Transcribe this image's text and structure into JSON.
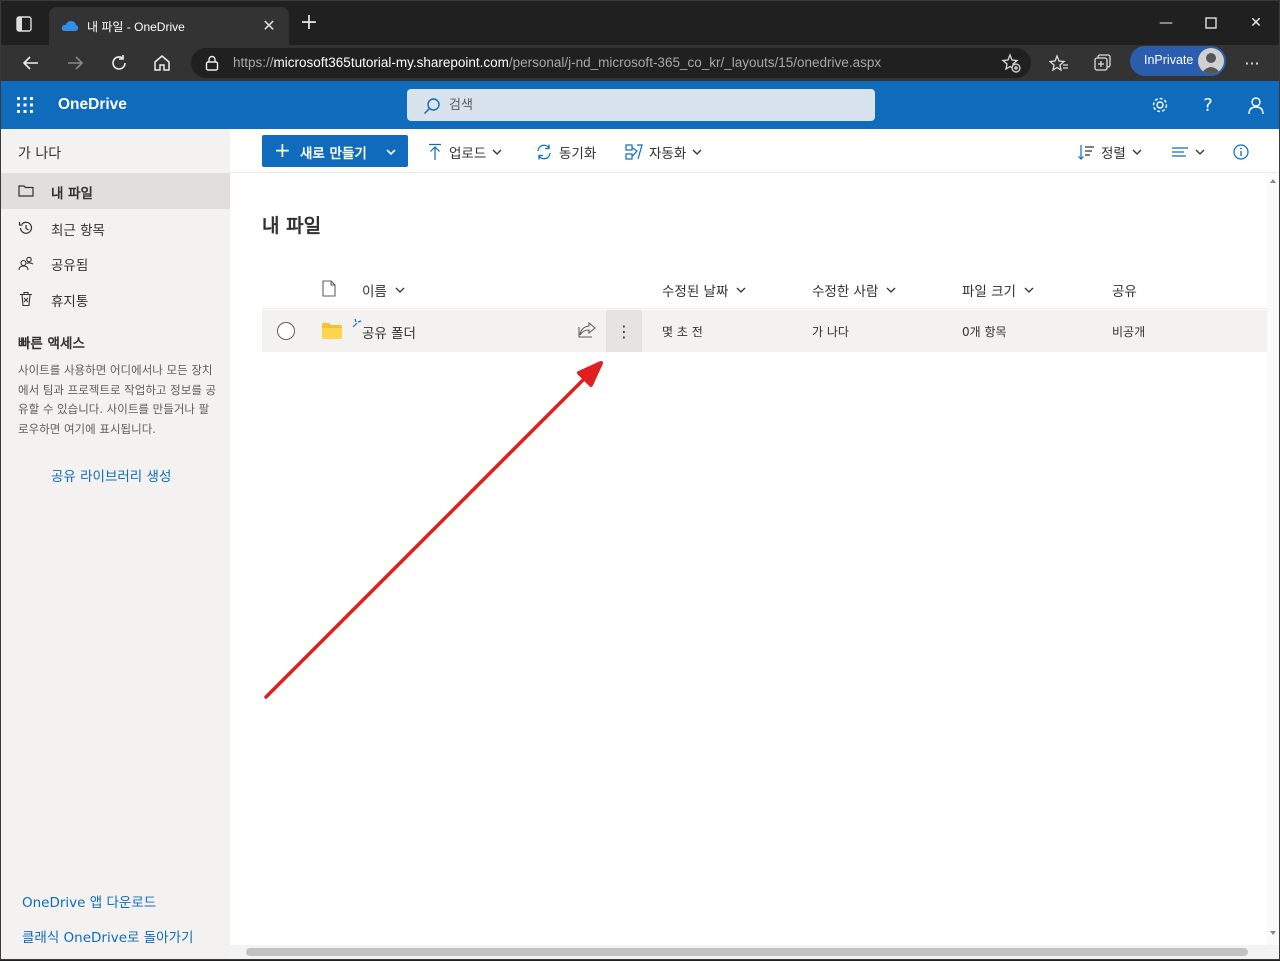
{
  "browser": {
    "tab_title": "내 파일 - OneDrive",
    "url_prefix": "https://",
    "url_host": "microsoft365tutorial-my.sharepoint.com",
    "url_path": "/personal/j-nd_microsoft-365_co_kr/_layouts/15/onedrive.aspx",
    "inprivate_label": "InPrivate"
  },
  "suite": {
    "brand": "OneDrive",
    "search_placeholder": "검색",
    "accent_color": "#0f6cbd"
  },
  "sidebar": {
    "user_name": "가 나다",
    "items": [
      {
        "label": "내 파일",
        "icon": "folder-icon",
        "active": true
      },
      {
        "label": "최근 항목",
        "icon": "history-icon",
        "active": false
      },
      {
        "label": "공유됨",
        "icon": "people-icon",
        "active": false
      },
      {
        "label": "휴지통",
        "icon": "trash-icon",
        "active": false
      }
    ],
    "quick_access_title": "빠른 액세스",
    "quick_access_desc": "사이트를 사용하면 어디에서나 모든 장치에서 팀과 프로젝트로 작업하고 정보를 공유할 수 있습니다. 사이트를 만들거나 팔로우하면 여기에 표시됩니다.",
    "create_library": "공유 라이브러리 생성",
    "download_app": "OneDrive 앱 다운로드",
    "classic": "클래식 OneDrive로 돌아가기"
  },
  "commands": {
    "new": "새로 만들기",
    "upload": "업로드",
    "sync": "동기화",
    "automate": "자동화",
    "sort": "정렬"
  },
  "main": {
    "title": "내 파일",
    "columns": {
      "name": "이름",
      "modified": "수정된 날짜",
      "modified_by": "수정한 사람",
      "size": "파일 크기",
      "sharing": "공유"
    },
    "rows": [
      {
        "name": "공유 폴더",
        "modified": "몇 초 전",
        "modified_by": "가 나다",
        "size": "0개 항목",
        "sharing": "비공개"
      }
    ]
  },
  "annotation": {
    "arrow_color": "#e02020"
  }
}
